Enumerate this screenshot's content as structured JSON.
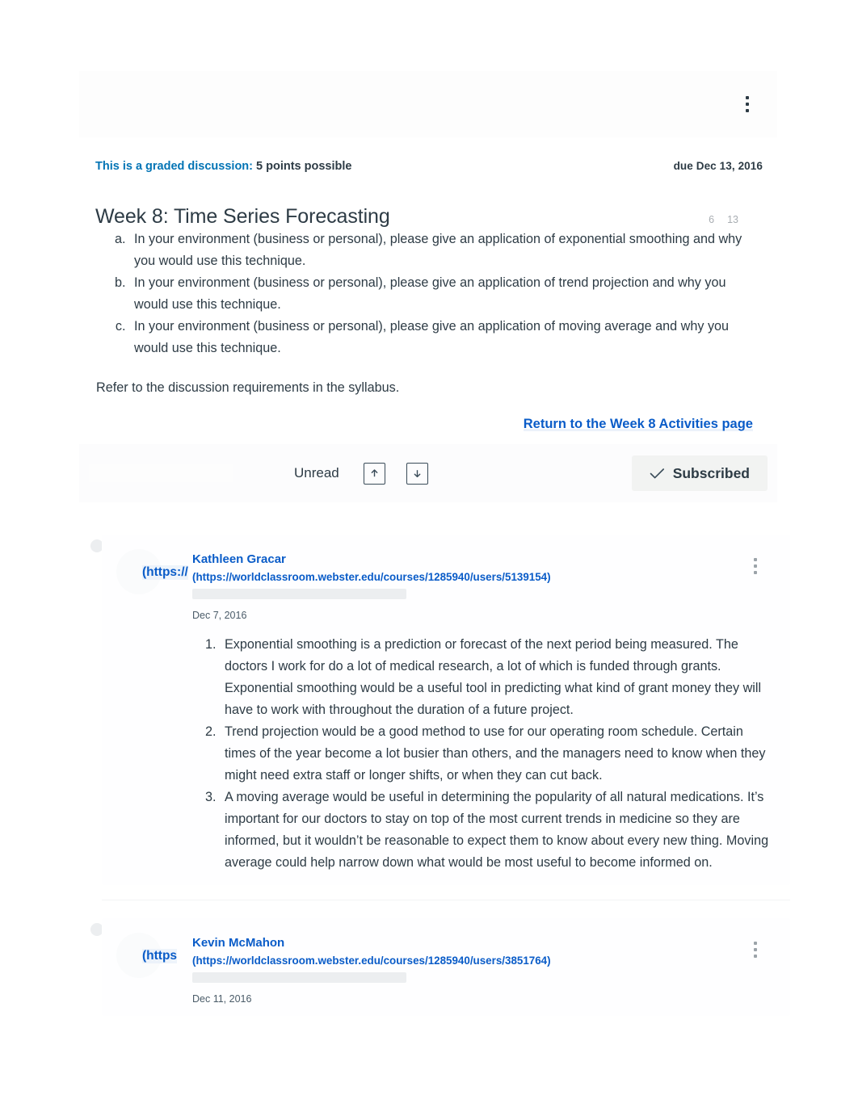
{
  "header": {
    "graded_label": "This is a graded discussion:",
    "points_possible": "5 points possible",
    "due_date": "due Dec 13, 2016",
    "title": "Week 8: Time Series Forecasting",
    "unread_count": "6",
    "reply_count": "13",
    "kebab_icon": "kebab-menu-icon"
  },
  "prompt": {
    "items": [
      "In your environment (business or personal), please give an application of exponential smoothing and why you would use this technique.",
      "In your environment (business or personal), please give an application of trend projection and why you would use this technique.",
      "In your environment (business or personal), please give an application of moving average and why you would use this technique."
    ],
    "refer_text": "Refer to the discussion requirements in the syllabus.",
    "return_link": "Return to the Week 8 Activities page"
  },
  "toolbar": {
    "unread_label": "Unread",
    "collapse_icon": "arrow-up-icon",
    "expand_icon": "arrow-down-icon",
    "subscribed_label": "Subscribed",
    "check_icon": "check-icon"
  },
  "replies": [
    {
      "avatar_url_fragment": "(https://",
      "author": "Kathleen Gracar",
      "author_link": "(https://worldclassroom.webster.edu/courses/1285940/users/5139154)",
      "date": "Dec 7, 2016",
      "kebab_icon": "kebab-menu-icon",
      "body": [
        "Exponential smoothing is a prediction or forecast of the next period being measured. The doctors I work for do a lot of medical research, a lot of which is funded through grants. Exponential smoothing would be a useful tool in predicting what kind of grant money they will have to work with throughout the duration of a future project.",
        "Trend projection would be a good method to use for our operating room schedule. Certain times of the year become a lot busier than others, and the managers need to know when they might need extra staff or longer shifts, or when they can cut back.",
        "A moving average would be useful in determining the popularity of all natural medications. It’s important for our doctors to stay on top of the most current trends in medicine so they are informed, but it wouldn’t be reasonable to expect them to know about every new thing. Moving average could help narrow down what would be most useful to become informed on."
      ]
    },
    {
      "avatar_url_fragment": "(https",
      "author": "Kevin McMahon",
      "author_link": "(https://worldclassroom.webster.edu/courses/1285940/users/3851764)",
      "date": "Dec 11, 2016",
      "kebab_icon": "kebab-menu-icon",
      "body": []
    }
  ],
  "colors": {
    "link_blue": "#0374b5",
    "url_blue": "#0a5cc8",
    "text": "#2d3b45",
    "muted": "#a8adb2"
  }
}
